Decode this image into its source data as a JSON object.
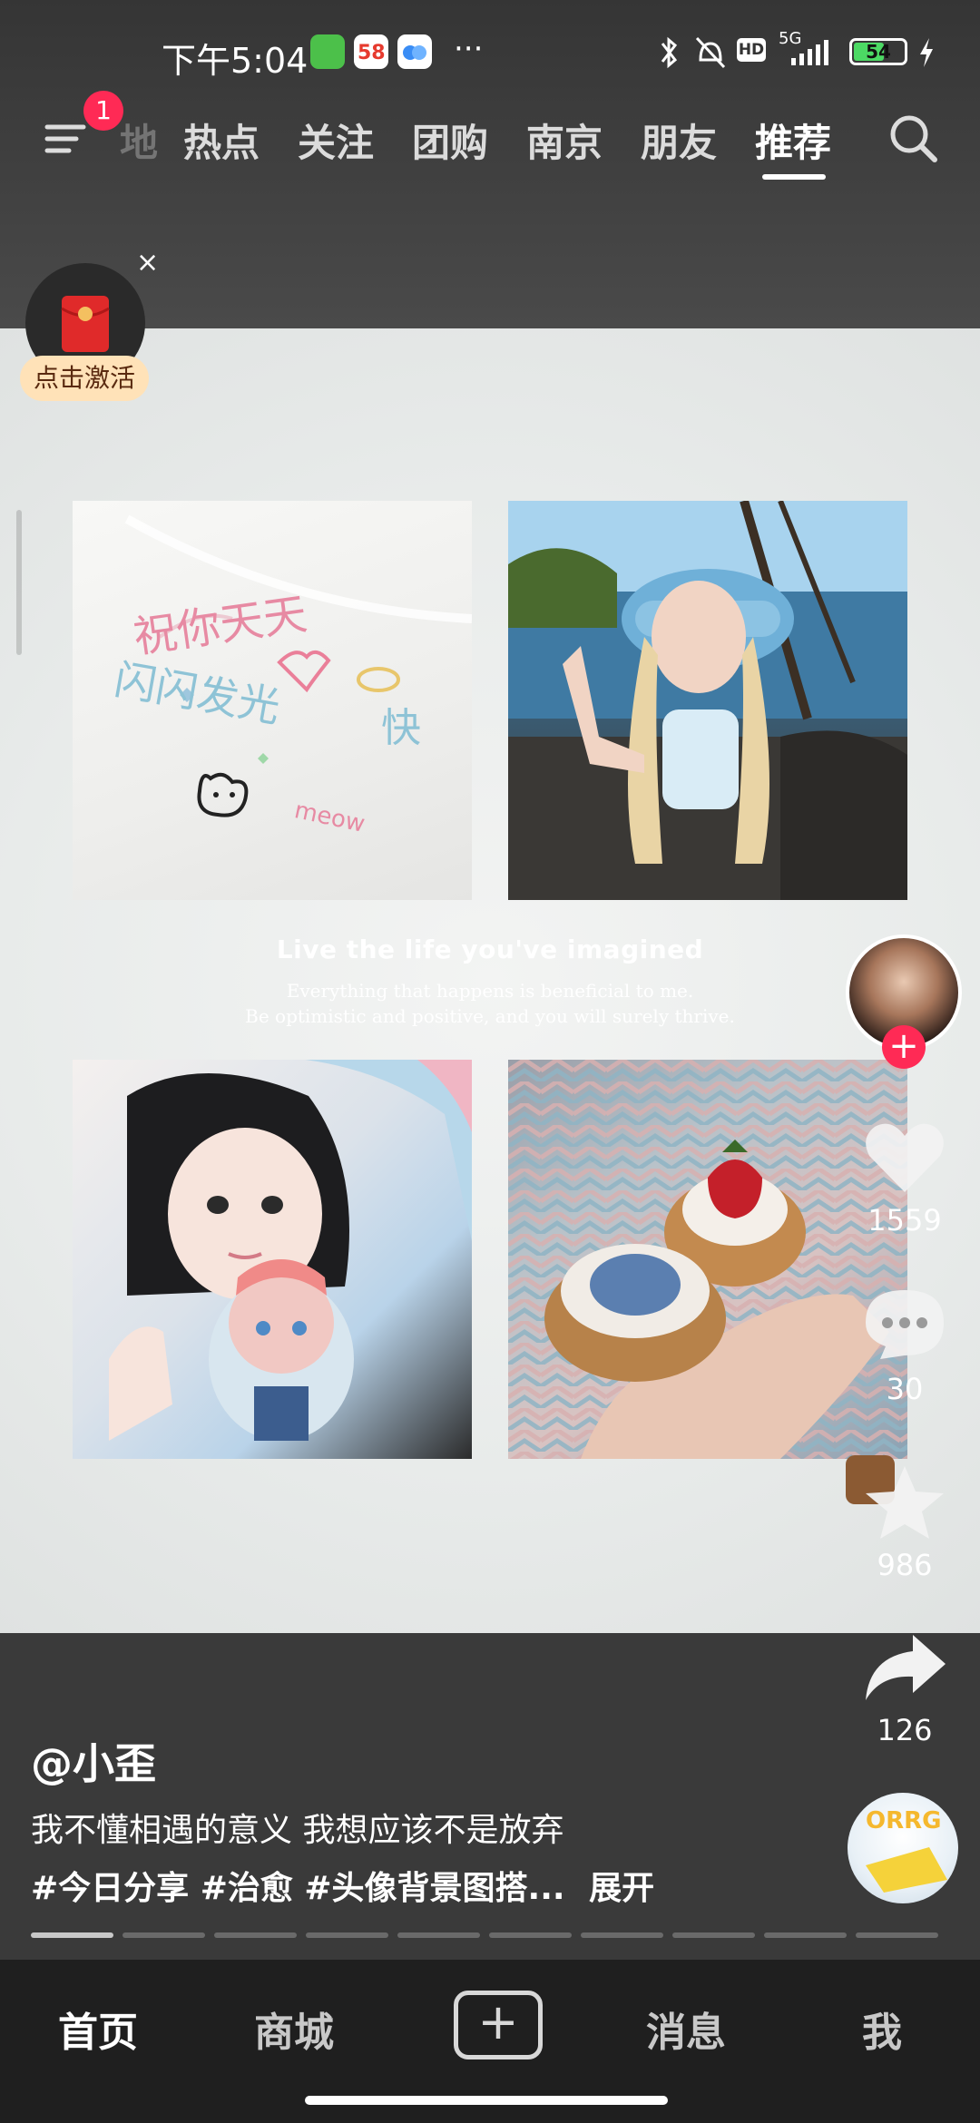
{
  "status_bar": {
    "time": "下午5:04",
    "network": "5G",
    "hd": "HD",
    "battery": "54",
    "more": "···"
  },
  "top_nav": {
    "badge": "1",
    "tabs": [
      "热点",
      "关注",
      "团购",
      "南京",
      "朋友",
      "推荐"
    ],
    "partial_tab": "地",
    "active_tab": "推荐"
  },
  "promo": {
    "activate_label": "点击激活",
    "close_label": "×"
  },
  "post": {
    "caption_title": "Live the life you've imagined",
    "caption_line1": "Everything that happens is beneficial to me.",
    "caption_line2": "Be optimistic and positive, and you will surely thrive.",
    "photo1_text_top": "祝你天天",
    "photo1_text_mid": "闪闪发光",
    "photo1_text_fast": "快",
    "photo1_meow": "meow",
    "author": "@小歪",
    "description": "我不懂相遇的意义 我想应该不是放弃",
    "tags": "#今日分享 #治愈 #头像背景图搭...",
    "expand_label": "展开",
    "progress_total": 10,
    "progress_current": 1
  },
  "right_rail": {
    "follow_label": "+",
    "likes": "1559",
    "comments": "30",
    "favorites": "986",
    "shares": "126",
    "music_label": "ORRG"
  },
  "tab_bar": {
    "home": "首页",
    "mall": "商城",
    "create": "+",
    "messages": "消息",
    "me": "我"
  },
  "colors": {
    "accent": "#ff2a55",
    "background": "#3a3a3a",
    "tabbar": "#1f1f1f"
  }
}
